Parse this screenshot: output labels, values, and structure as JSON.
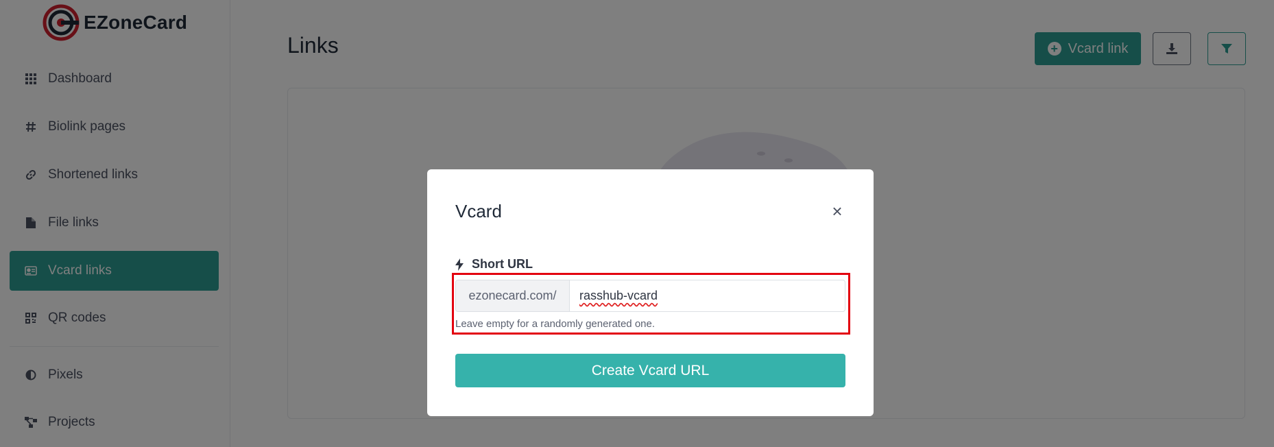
{
  "brand": {
    "name": "EZoneCard"
  },
  "sidebar": {
    "items": [
      {
        "label": "Dashboard",
        "icon": "grid-icon"
      },
      {
        "label": "Biolink pages",
        "icon": "hash-icon"
      },
      {
        "label": "Shortened links",
        "icon": "link-icon"
      },
      {
        "label": "File links",
        "icon": "file-icon"
      },
      {
        "label": "Vcard links",
        "icon": "id-card-icon",
        "active": true
      },
      {
        "label": "QR codes",
        "icon": "qrcode-icon"
      },
      {
        "label": "Pixels",
        "icon": "adjust-icon"
      },
      {
        "label": "Projects",
        "icon": "project-diagram-icon"
      }
    ]
  },
  "main": {
    "title": "Links",
    "create_button_label": "Vcard link"
  },
  "modal": {
    "title": "Vcard",
    "close_symbol": "×",
    "field_label": "Short URL",
    "url_prefix": "ezonecard.com/",
    "url_value": "rasshub-vcard",
    "help_text": "Leave empty for a randomly generated one.",
    "submit_label": "Create Vcard URL"
  },
  "colors": {
    "accent": "#2c9d93",
    "submit": "#36b2ab",
    "highlight": "#e3000f"
  }
}
